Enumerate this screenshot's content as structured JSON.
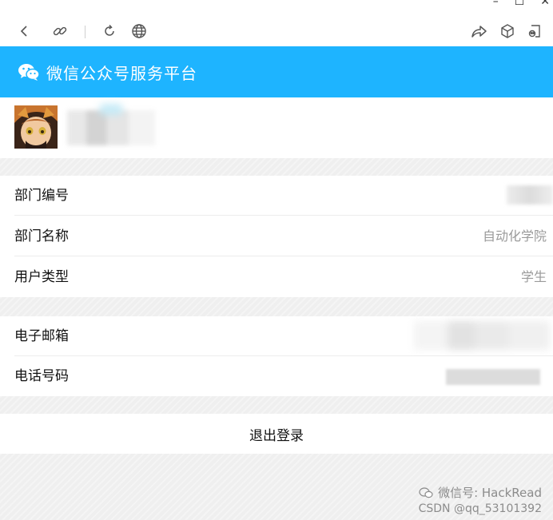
{
  "window": {
    "controls": {
      "minimize": "–",
      "maximize": "☐",
      "close": "✕"
    }
  },
  "toolbar": {
    "icons": [
      "back-icon",
      "link-icon",
      "refresh-icon",
      "globe-icon",
      "share-icon",
      "cube-icon",
      "screenshot-icon"
    ]
  },
  "header": {
    "title": "微信公众号服务平台",
    "bg_color": "#1eb4ff"
  },
  "profile": {
    "avatar": "anime-avatar"
  },
  "info": {
    "dept_no": {
      "label": "部门编号",
      "value": ""
    },
    "dept_name": {
      "label": "部门名称",
      "value": "自动化学院"
    },
    "user_type": {
      "label": "用户类型",
      "value": "学生"
    }
  },
  "contact": {
    "email": {
      "label": "电子邮箱",
      "value": ""
    },
    "phone": {
      "label": "电话号码",
      "value": ""
    }
  },
  "actions": {
    "logout_label": "退出登录"
  },
  "watermark": {
    "line1": "微信号: HackRead",
    "line2": "CSDN @qq_53101392"
  }
}
